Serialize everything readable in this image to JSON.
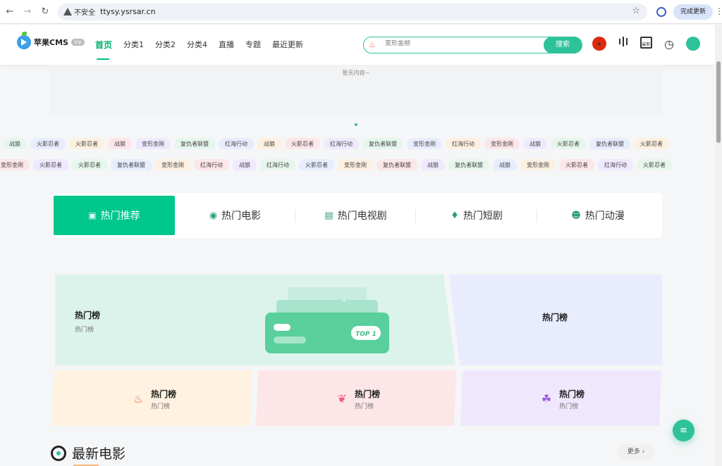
{
  "browser": {
    "security_label": "不安全",
    "url": "ttysy.ysrsar.cn",
    "update_label": "完成更新"
  },
  "header": {
    "logo_text": "苹果CMS",
    "logo_badge": "Vip",
    "nav": [
      "首页",
      "分类1",
      "分类2",
      "分类4",
      "直播",
      "专题",
      "最近更新"
    ],
    "search_placeholder": "变形金刚",
    "search_button": "搜索",
    "icons": [
      "china-flag-icon",
      "ranking-icon",
      "latest-icon",
      "history-icon",
      "user-icon"
    ],
    "latest_icon_label": "最新"
  },
  "banner": {
    "empty_text": "暂无内容~"
  },
  "tags": {
    "row1": [
      "战狼",
      "火影忍者",
      "火影忍者",
      "战狼",
      "变形金刚",
      "复仇者联盟",
      "红海行动",
      "战狼",
      "火影忍者",
      "红海行动",
      "复仇者联盟",
      "变形金刚",
      "红海行动",
      "变形金刚",
      "战狼",
      "火影忍者",
      "复仇者联盟",
      "火影忍者"
    ],
    "row2": [
      "变形金刚",
      "火影忍者",
      "火影忍者",
      "复仇者联盟",
      "变形金刚",
      "红海行动",
      "战狼",
      "红海行动",
      "火影忍者",
      "变形金刚",
      "复仇者联盟",
      "战狼",
      "复仇者联盟",
      "战狼",
      "变形金刚",
      "火影忍者",
      "红海行动",
      "火影忍者"
    ]
  },
  "tabs": [
    {
      "label": "热门推荐",
      "icon": "video-icon"
    },
    {
      "label": "热门电影",
      "icon": "film-reel-icon"
    },
    {
      "label": "热门电视剧",
      "icon": "tv-icon"
    },
    {
      "label": "热门短剧",
      "icon": "short-drama-icon"
    },
    {
      "label": "热门动漫",
      "icon": "anime-icon"
    }
  ],
  "hot": {
    "main_title": "热门榜",
    "main_sub": "热门榜",
    "top_label": "TOP 1",
    "right_title": "热门榜",
    "cards": [
      {
        "title": "热门榜",
        "sub": "热门榜",
        "icon": "fire-icon"
      },
      {
        "title": "热门榜",
        "sub": "热门榜",
        "icon": "bow-icon"
      },
      {
        "title": "热门榜",
        "sub": "热门榜",
        "icon": "ghost-icon"
      }
    ]
  },
  "latest": {
    "title": "最新电影",
    "more": "更多"
  },
  "colors": {
    "accent": "#00c78c"
  }
}
